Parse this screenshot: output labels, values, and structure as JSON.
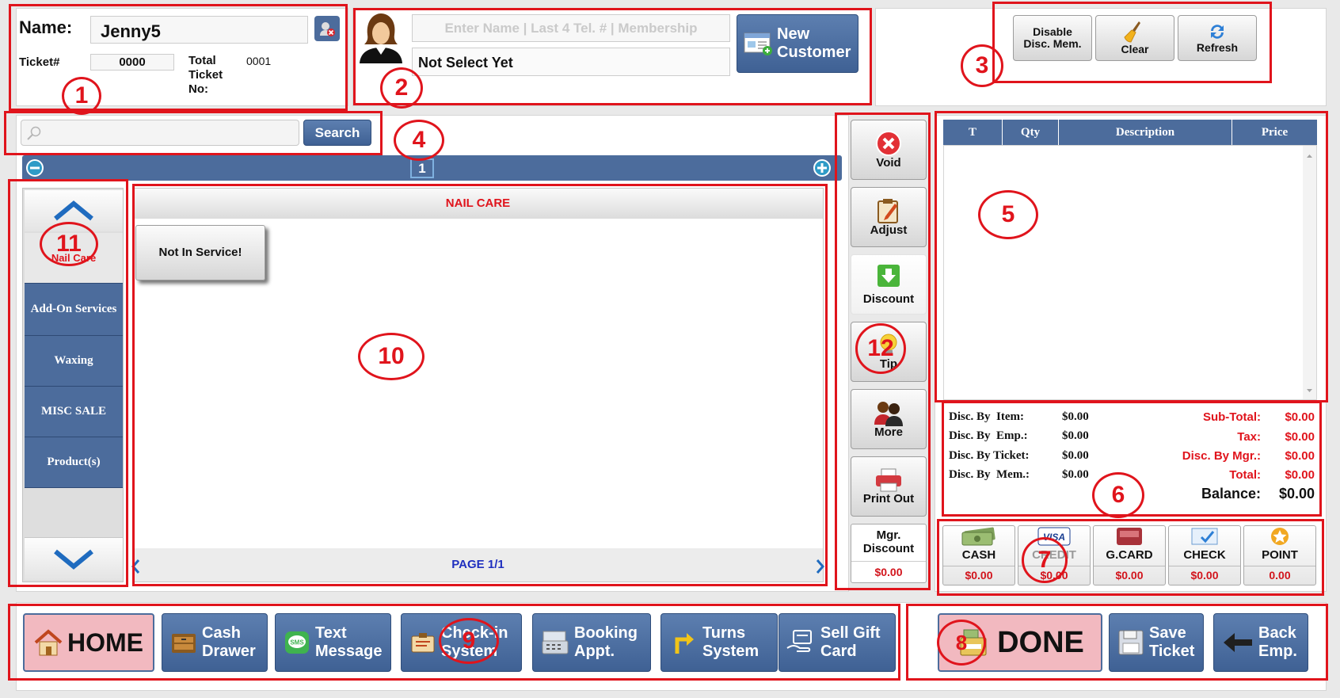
{
  "customer": {
    "name_label": "Name:",
    "name_value": "Jenny5",
    "ticket_label": "Ticket#",
    "ticket_value": "0000",
    "total_ticket_label": "Total Ticket No:",
    "total_ticket_value": "0001"
  },
  "lookup": {
    "search_placeholder": "Enter Name | Last 4 Tel. # | Membership",
    "selected": "Not Select Yet",
    "new_customer_label": "New Customer"
  },
  "top_actions": {
    "disable_disc_label": "Disable Disc. Mem.",
    "clear_label": "Clear",
    "refresh_label": "Refresh"
  },
  "search": {
    "input_value": "",
    "button_label": "Search"
  },
  "pager": {
    "current_page": "1"
  },
  "categories": {
    "items": [
      "Nail Care",
      "Add-On Services",
      "Waxing",
      "MISC SALE",
      "Product(s)"
    ],
    "selected": "Nail Care"
  },
  "services": {
    "header": "NAIL CARE",
    "items": [
      "Not In Service!"
    ],
    "page_label": "PAGE 1/1"
  },
  "ticket_actions": {
    "void": "Void",
    "adjust": "Adjust",
    "discount": "Discount",
    "tip": "Tip",
    "more": "More",
    "print": "Print Out",
    "mgr_discount": "Mgr. Discount",
    "mgr_discount_value": "$0.00"
  },
  "ticket_table": {
    "columns": [
      "T",
      "Qty",
      "Description",
      "Price"
    ],
    "rows": []
  },
  "totals": {
    "disc_item_label": "Disc. By  Item:",
    "disc_item": "$0.00",
    "disc_emp_label": "Disc. By  Emp.:",
    "disc_emp": "$0.00",
    "disc_ticket_label": "Disc. By Ticket:",
    "disc_ticket": "$0.00",
    "disc_mem_label": "Disc. By  Mem.:",
    "disc_mem": "$0.00",
    "subtotal_label": "Sub-Total:",
    "subtotal": "$0.00",
    "tax_label": "Tax:",
    "tax": "$0.00",
    "disc_mgr_label": "Disc. By Mgr.:",
    "disc_mgr": "$0.00",
    "total_label": "Total:",
    "total": "$0.00",
    "balance_label": "Balance:",
    "balance": "$0.00"
  },
  "payments": [
    {
      "label": "CASH",
      "amount": "$0.00"
    },
    {
      "label": "CREDIT",
      "amount": "$0.00"
    },
    {
      "label": "G.CARD",
      "amount": "$0.00"
    },
    {
      "label": "CHECK",
      "amount": "$0.00"
    },
    {
      "label": "POINT",
      "amount": "0.00"
    }
  ],
  "bottom_nav": {
    "home": "HOME",
    "cash_drawer": "Cash Drawer",
    "text_message": "Text Message",
    "checkin": "Check-in System",
    "booking": "Booking Appt.",
    "turns": "Turns System",
    "sell_gift": "Sell Gift Card",
    "done": "DONE",
    "save_ticket": "Save Ticket",
    "back_emp": "Back Emp."
  },
  "annotations": [
    "1",
    "2",
    "3",
    "4",
    "5",
    "6",
    "7",
    "8",
    "9",
    "10",
    "11",
    "12"
  ],
  "colors": {
    "accent_blue": "#4c6c9c",
    "annotation_red": "#e0141c",
    "home_pink": "#f2b9c0"
  }
}
